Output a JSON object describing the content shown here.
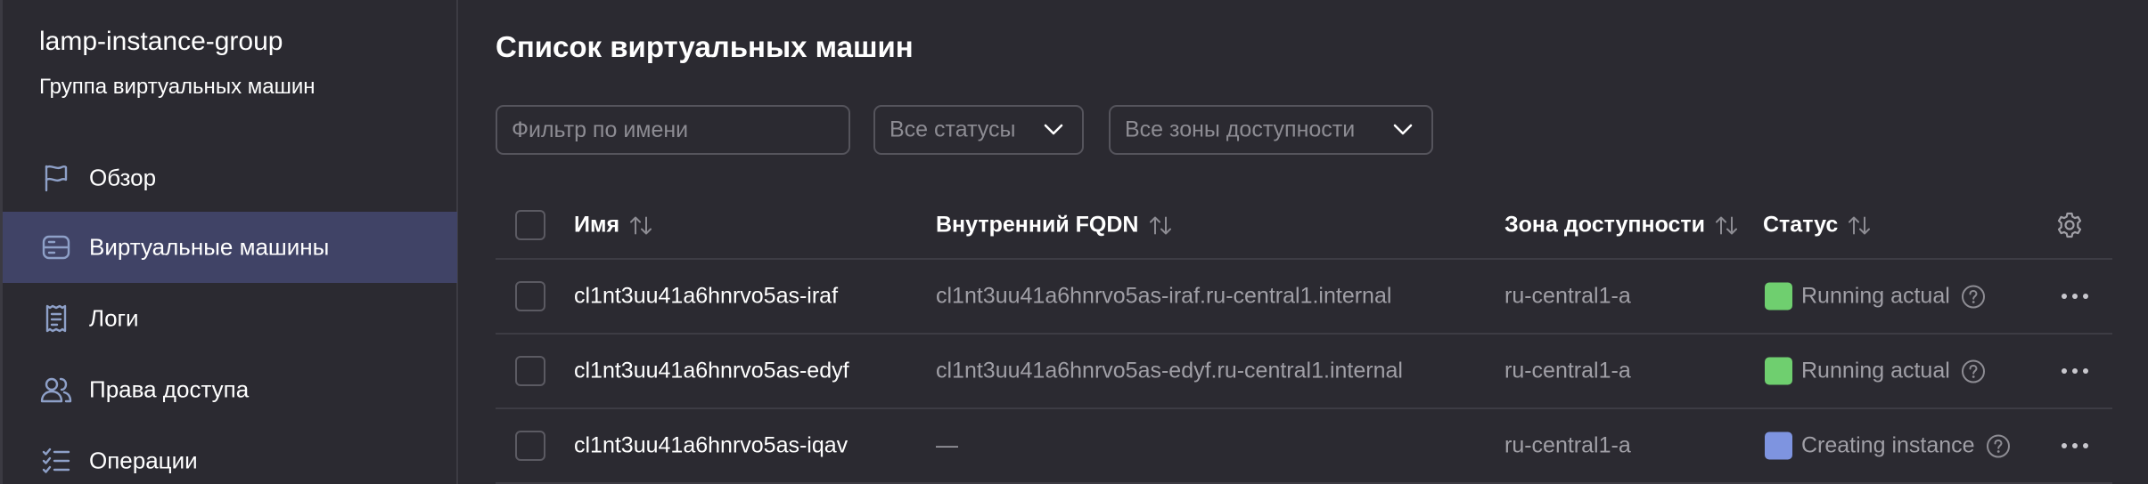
{
  "sidebar": {
    "title": "lamp-instance-group",
    "subtitle": "Группа виртуальных машин",
    "items": [
      {
        "label": "Обзор",
        "icon": "flag-icon"
      },
      {
        "label": "Виртуальные машины",
        "icon": "server-icon",
        "active": true
      },
      {
        "label": "Логи",
        "icon": "log-icon"
      },
      {
        "label": "Права доступа",
        "icon": "users-icon"
      },
      {
        "label": "Операции",
        "icon": "list-check-icon"
      }
    ]
  },
  "main": {
    "title": "Список виртуальных машин",
    "filters": {
      "name_placeholder": "Фильтр по имени",
      "status_select": "Все статусы",
      "zone_select": "Все зоны доступности"
    },
    "table": {
      "columns": {
        "name": "Имя",
        "fqdn": "Внутренний FQDN",
        "zone": "Зона доступности",
        "status": "Статус"
      },
      "rows": [
        {
          "name": "cl1nt3uu41a6hnrvo5as-iraf",
          "fqdn": "cl1nt3uu41a6hnrvo5as-iraf.ru-central1.internal",
          "zone": "ru-central1-a",
          "status": "Running actual",
          "status_color": "#6fcf6f"
        },
        {
          "name": "cl1nt3uu41a6hnrvo5as-edyf",
          "fqdn": "cl1nt3uu41a6hnrvo5as-edyf.ru-central1.internal",
          "zone": "ru-central1-a",
          "status": "Running actual",
          "status_color": "#6fcf6f"
        },
        {
          "name": "cl1nt3uu41a6hnrvo5as-iqav",
          "fqdn": "—",
          "zone": "ru-central1-a",
          "status": "Creating instance",
          "status_color": "#7e94e0"
        }
      ]
    }
  },
  "colors": {
    "background": "#2b2a31",
    "active_nav": "#404366",
    "running": "#6fcf6f",
    "creating": "#7e94e0"
  }
}
